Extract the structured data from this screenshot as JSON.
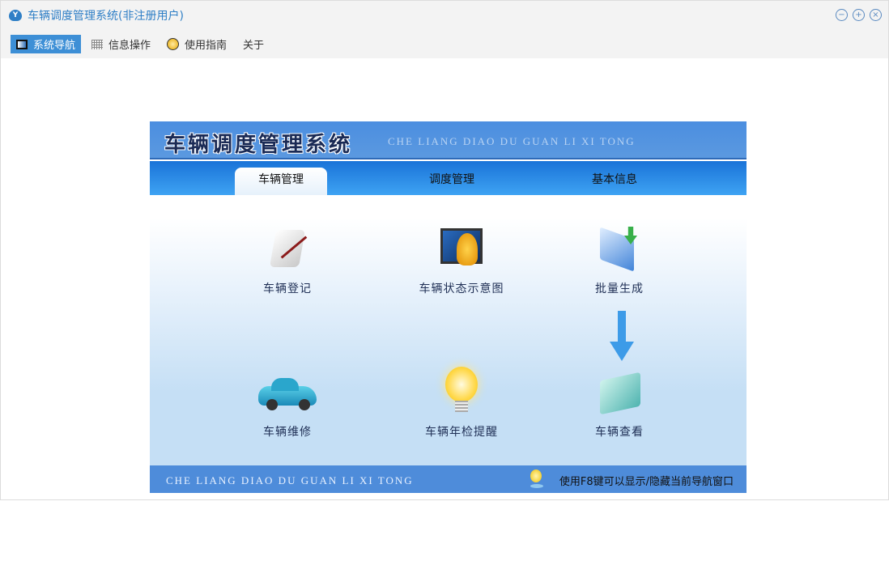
{
  "window": {
    "title": "车辆调度管理系统(非注册用户)",
    "controls": [
      "minimize",
      "maximize",
      "close"
    ]
  },
  "menu": [
    {
      "label": "系统导航",
      "icon": "monitor-icon",
      "active": true
    },
    {
      "label": "信息操作",
      "icon": "grid-icon"
    },
    {
      "label": "使用指南",
      "icon": "help-icon"
    },
    {
      "label": "关于"
    }
  ],
  "panel": {
    "title": "车辆调度管理系统",
    "pinyin": "CHE LIANG DIAO DU GUAN LI XI TONG",
    "tabs": [
      {
        "label": "车辆管理",
        "active": true
      },
      {
        "label": "调度管理"
      },
      {
        "label": "基本信息"
      }
    ],
    "items": [
      {
        "label": "车辆登记",
        "icon": "scroll-pen-icon"
      },
      {
        "label": "车辆状态示意图",
        "icon": "monitor-arrow-icon"
      },
      {
        "label": "批量生成",
        "icon": "documents-download-icon"
      },
      {
        "label": "车辆维修",
        "icon": "car-icon"
      },
      {
        "label": "车辆年检提醒",
        "icon": "lightbulb-icon"
      },
      {
        "label": "车辆查看",
        "icon": "folder-icon"
      }
    ],
    "footer_pinyin": "CHE LIANG DIAO DU GUAN LI XI TONG",
    "footer_hint": "使用F8键可以显示/隐藏当前导航窗口"
  }
}
